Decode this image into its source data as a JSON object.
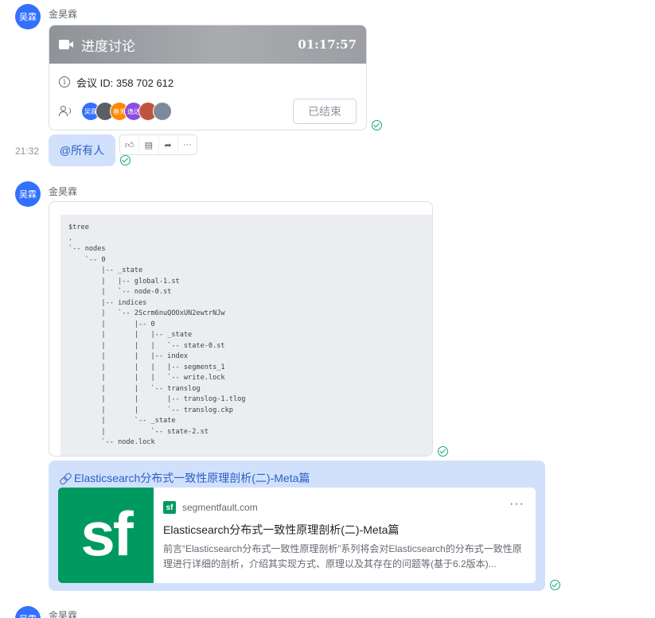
{
  "messages": {
    "first": {
      "avatar_text": "吴霖",
      "sender": "金昊霖",
      "meeting": {
        "title": "进度讨论",
        "duration": "01:17:57",
        "id_label": "会议 ID: 358 702 612",
        "participants": [
          {
            "label": "吴霖",
            "color": "#3370ff"
          },
          {
            "label": "",
            "color": "#5a5f66"
          },
          {
            "label": "春天",
            "color": "#ff8800"
          },
          {
            "label": "逸达",
            "color": "#8b4fe0"
          },
          {
            "label": "",
            "color": "#c1543c"
          },
          {
            "label": "",
            "color": "#7d8a99"
          }
        ],
        "status_button": "已结束"
      }
    },
    "second": {
      "time": "21:32",
      "text": "@所有人",
      "actions": [
        "thumbs-up-icon",
        "reply-icon",
        "forward-icon",
        "more-icon"
      ]
    },
    "third": {
      "avatar_text": "吴霖",
      "sender": "金昊霖",
      "code": "$tree\n.\n`-- nodes\n    `-- 0\n        |-- _state\n        |   |-- global-1.st\n        |   `-- node-0.st\n        |-- indices\n        |   `-- 2Scrm6nuQOOxUN2ewtrNJw\n        |       |-- 0\n        |       |   |-- _state\n        |       |   |   `-- state-0.st\n        |       |   |-- index\n        |       |   |   |-- segments_1\n        |       |   |   `-- write.lock\n        |       |   `-- translog\n        |       |       |-- translog-1.tlog\n        |       |       `-- translog.ckp\n        |       `-- _state\n        |           `-- state-2.st\n        `-- node.lock",
      "link": {
        "title": "Elasticsearch分布式一致性原理剖析(二)-Meta篇",
        "logo_text": "sf",
        "site_fav": "sf",
        "site": "segmentfault.com",
        "more": "···",
        "preview_title": "Elasticsearch分布式一致性原理剖析(二)-Meta篇",
        "preview_desc": "前言“Elasticsearch分布式一致性原理剖析”系列将会对Elasticsearch的分布式一致性原理进行详细的剖析，介绍其实现方式、原理以及其存在的问题等(基于6.2版本)..."
      }
    },
    "fourth": {
      "avatar_text": "吴霖",
      "sender": "金昊霖"
    }
  },
  "colors": {
    "accent": "#3370ff",
    "bubble": "#d1e1fc",
    "link": "#2a5fc6",
    "read_check": "#14a77a",
    "sf_green": "#009a61"
  }
}
